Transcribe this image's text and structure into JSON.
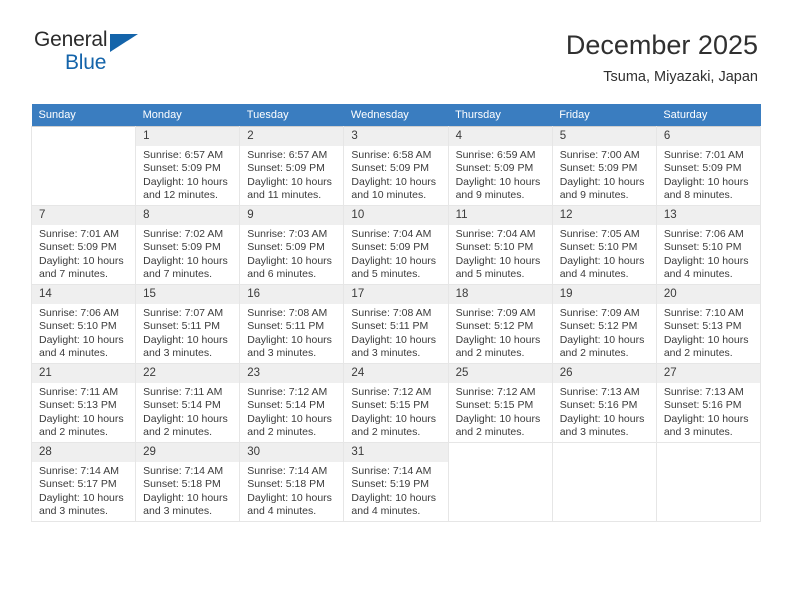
{
  "brand": {
    "name_top": "General",
    "name_bottom": "Blue",
    "triangle_color": "#1464aa"
  },
  "header": {
    "title": "December 2025",
    "subtitle": "Tsuma, Miyazaki, Japan"
  },
  "calendar": {
    "header_bg": "#3a7dc0",
    "weekdays": [
      "Sunday",
      "Monday",
      "Tuesday",
      "Wednesday",
      "Thursday",
      "Friday",
      "Saturday"
    ],
    "weeks": [
      [
        {
          "day": "",
          "sunrise": "",
          "sunset": "",
          "daylight": ""
        },
        {
          "day": "1",
          "sunrise": "Sunrise: 6:57 AM",
          "sunset": "Sunset: 5:09 PM",
          "daylight": "Daylight: 10 hours and 12 minutes."
        },
        {
          "day": "2",
          "sunrise": "Sunrise: 6:57 AM",
          "sunset": "Sunset: 5:09 PM",
          "daylight": "Daylight: 10 hours and 11 minutes."
        },
        {
          "day": "3",
          "sunrise": "Sunrise: 6:58 AM",
          "sunset": "Sunset: 5:09 PM",
          "daylight": "Daylight: 10 hours and 10 minutes."
        },
        {
          "day": "4",
          "sunrise": "Sunrise: 6:59 AM",
          "sunset": "Sunset: 5:09 PM",
          "daylight": "Daylight: 10 hours and 9 minutes."
        },
        {
          "day": "5",
          "sunrise": "Sunrise: 7:00 AM",
          "sunset": "Sunset: 5:09 PM",
          "daylight": "Daylight: 10 hours and 9 minutes."
        },
        {
          "day": "6",
          "sunrise": "Sunrise: 7:01 AM",
          "sunset": "Sunset: 5:09 PM",
          "daylight": "Daylight: 10 hours and 8 minutes."
        }
      ],
      [
        {
          "day": "7",
          "sunrise": "Sunrise: 7:01 AM",
          "sunset": "Sunset: 5:09 PM",
          "daylight": "Daylight: 10 hours and 7 minutes."
        },
        {
          "day": "8",
          "sunrise": "Sunrise: 7:02 AM",
          "sunset": "Sunset: 5:09 PM",
          "daylight": "Daylight: 10 hours and 7 minutes."
        },
        {
          "day": "9",
          "sunrise": "Sunrise: 7:03 AM",
          "sunset": "Sunset: 5:09 PM",
          "daylight": "Daylight: 10 hours and 6 minutes."
        },
        {
          "day": "10",
          "sunrise": "Sunrise: 7:04 AM",
          "sunset": "Sunset: 5:09 PM",
          "daylight": "Daylight: 10 hours and 5 minutes."
        },
        {
          "day": "11",
          "sunrise": "Sunrise: 7:04 AM",
          "sunset": "Sunset: 5:10 PM",
          "daylight": "Daylight: 10 hours and 5 minutes."
        },
        {
          "day": "12",
          "sunrise": "Sunrise: 7:05 AM",
          "sunset": "Sunset: 5:10 PM",
          "daylight": "Daylight: 10 hours and 4 minutes."
        },
        {
          "day": "13",
          "sunrise": "Sunrise: 7:06 AM",
          "sunset": "Sunset: 5:10 PM",
          "daylight": "Daylight: 10 hours and 4 minutes."
        }
      ],
      [
        {
          "day": "14",
          "sunrise": "Sunrise: 7:06 AM",
          "sunset": "Sunset: 5:10 PM",
          "daylight": "Daylight: 10 hours and 4 minutes."
        },
        {
          "day": "15",
          "sunrise": "Sunrise: 7:07 AM",
          "sunset": "Sunset: 5:11 PM",
          "daylight": "Daylight: 10 hours and 3 minutes."
        },
        {
          "day": "16",
          "sunrise": "Sunrise: 7:08 AM",
          "sunset": "Sunset: 5:11 PM",
          "daylight": "Daylight: 10 hours and 3 minutes."
        },
        {
          "day": "17",
          "sunrise": "Sunrise: 7:08 AM",
          "sunset": "Sunset: 5:11 PM",
          "daylight": "Daylight: 10 hours and 3 minutes."
        },
        {
          "day": "18",
          "sunrise": "Sunrise: 7:09 AM",
          "sunset": "Sunset: 5:12 PM",
          "daylight": "Daylight: 10 hours and 2 minutes."
        },
        {
          "day": "19",
          "sunrise": "Sunrise: 7:09 AM",
          "sunset": "Sunset: 5:12 PM",
          "daylight": "Daylight: 10 hours and 2 minutes."
        },
        {
          "day": "20",
          "sunrise": "Sunrise: 7:10 AM",
          "sunset": "Sunset: 5:13 PM",
          "daylight": "Daylight: 10 hours and 2 minutes."
        }
      ],
      [
        {
          "day": "21",
          "sunrise": "Sunrise: 7:11 AM",
          "sunset": "Sunset: 5:13 PM",
          "daylight": "Daylight: 10 hours and 2 minutes."
        },
        {
          "day": "22",
          "sunrise": "Sunrise: 7:11 AM",
          "sunset": "Sunset: 5:14 PM",
          "daylight": "Daylight: 10 hours and 2 minutes."
        },
        {
          "day": "23",
          "sunrise": "Sunrise: 7:12 AM",
          "sunset": "Sunset: 5:14 PM",
          "daylight": "Daylight: 10 hours and 2 minutes."
        },
        {
          "day": "24",
          "sunrise": "Sunrise: 7:12 AM",
          "sunset": "Sunset: 5:15 PM",
          "daylight": "Daylight: 10 hours and 2 minutes."
        },
        {
          "day": "25",
          "sunrise": "Sunrise: 7:12 AM",
          "sunset": "Sunset: 5:15 PM",
          "daylight": "Daylight: 10 hours and 2 minutes."
        },
        {
          "day": "26",
          "sunrise": "Sunrise: 7:13 AM",
          "sunset": "Sunset: 5:16 PM",
          "daylight": "Daylight: 10 hours and 3 minutes."
        },
        {
          "day": "27",
          "sunrise": "Sunrise: 7:13 AM",
          "sunset": "Sunset: 5:16 PM",
          "daylight": "Daylight: 10 hours and 3 minutes."
        }
      ],
      [
        {
          "day": "28",
          "sunrise": "Sunrise: 7:14 AM",
          "sunset": "Sunset: 5:17 PM",
          "daylight": "Daylight: 10 hours and 3 minutes."
        },
        {
          "day": "29",
          "sunrise": "Sunrise: 7:14 AM",
          "sunset": "Sunset: 5:18 PM",
          "daylight": "Daylight: 10 hours and 3 minutes."
        },
        {
          "day": "30",
          "sunrise": "Sunrise: 7:14 AM",
          "sunset": "Sunset: 5:18 PM",
          "daylight": "Daylight: 10 hours and 4 minutes."
        },
        {
          "day": "31",
          "sunrise": "Sunrise: 7:14 AM",
          "sunset": "Sunset: 5:19 PM",
          "daylight": "Daylight: 10 hours and 4 minutes."
        },
        {
          "day": "",
          "sunrise": "",
          "sunset": "",
          "daylight": ""
        },
        {
          "day": "",
          "sunrise": "",
          "sunset": "",
          "daylight": ""
        },
        {
          "day": "",
          "sunrise": "",
          "sunset": "",
          "daylight": ""
        }
      ]
    ]
  }
}
